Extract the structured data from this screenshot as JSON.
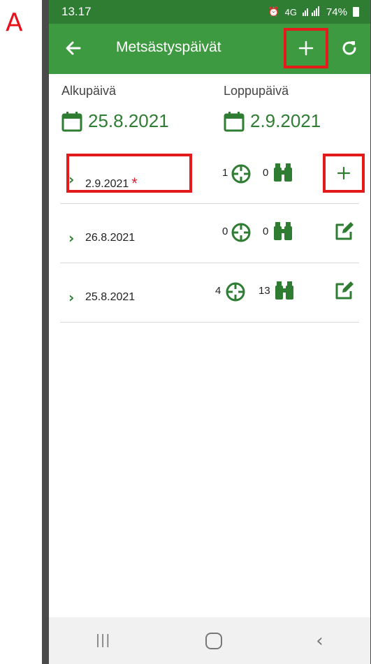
{
  "figure_label": "A",
  "status_bar": {
    "time": "13.17",
    "network": "4G",
    "battery": "74%"
  },
  "app_bar": {
    "title": "Metsästyspäivät",
    "back_icon": "arrow-left-icon",
    "add_icon": "plus-icon",
    "refresh_icon": "refresh-icon"
  },
  "date_range": {
    "start_label": "Alkupäivä",
    "start_value": "25.8.2021",
    "end_label": "Loppupäivä",
    "end_value": "2.9.2021"
  },
  "days": [
    {
      "date": "2.9.2021",
      "required": "*",
      "shots": "1",
      "observations": "0",
      "action": "add"
    },
    {
      "date": "26.8.2021",
      "required": "",
      "shots": "0",
      "observations": "0",
      "action": "edit"
    },
    {
      "date": "25.8.2021",
      "required": "",
      "shots": "4",
      "observations": "13",
      "action": "edit"
    }
  ],
  "colors": {
    "primary": "#3d9a40",
    "status": "#2e7d32",
    "highlight": "#e31b1b",
    "required": "#dd2233"
  }
}
